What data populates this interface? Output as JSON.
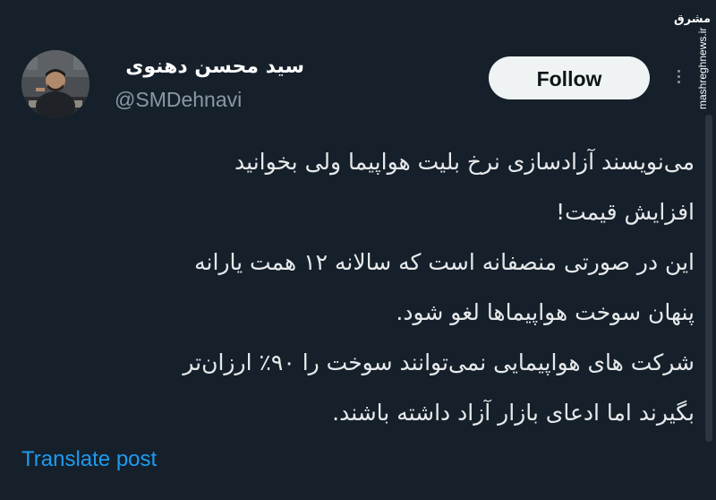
{
  "author": {
    "display_name": "سید محسن دهنوی",
    "handle": "@SMDehnavi"
  },
  "actions": {
    "follow_label": "Follow",
    "more_icon": "more-dots-vertical-icon"
  },
  "tweet": {
    "lines": [
      "می‌نویسند آزادسازی نرخ بلیت هواپیما ولی بخوانید",
      "افزایش قیمت!",
      "این در صورتی منصفانه است که سالانه ۱۲ همت یارانه",
      "پنهان سوخت هواپیماها لغو شود.",
      "شرکت های هواپیمایی نمی‌توانند سوخت را ۹۰٪ ارزان‌تر",
      "بگیرند اما ادعای بازار آزاد داشته باشند."
    ],
    "translate_label": "Translate post"
  },
  "watermark": {
    "logo_text": "مشرق",
    "site": "mashreghnews.ir"
  },
  "colors": {
    "background": "#15202b",
    "text": "#e7e9ea",
    "muted": "#8b98a5",
    "link": "#1d9bf0",
    "button_bg": "#eff3f4"
  }
}
